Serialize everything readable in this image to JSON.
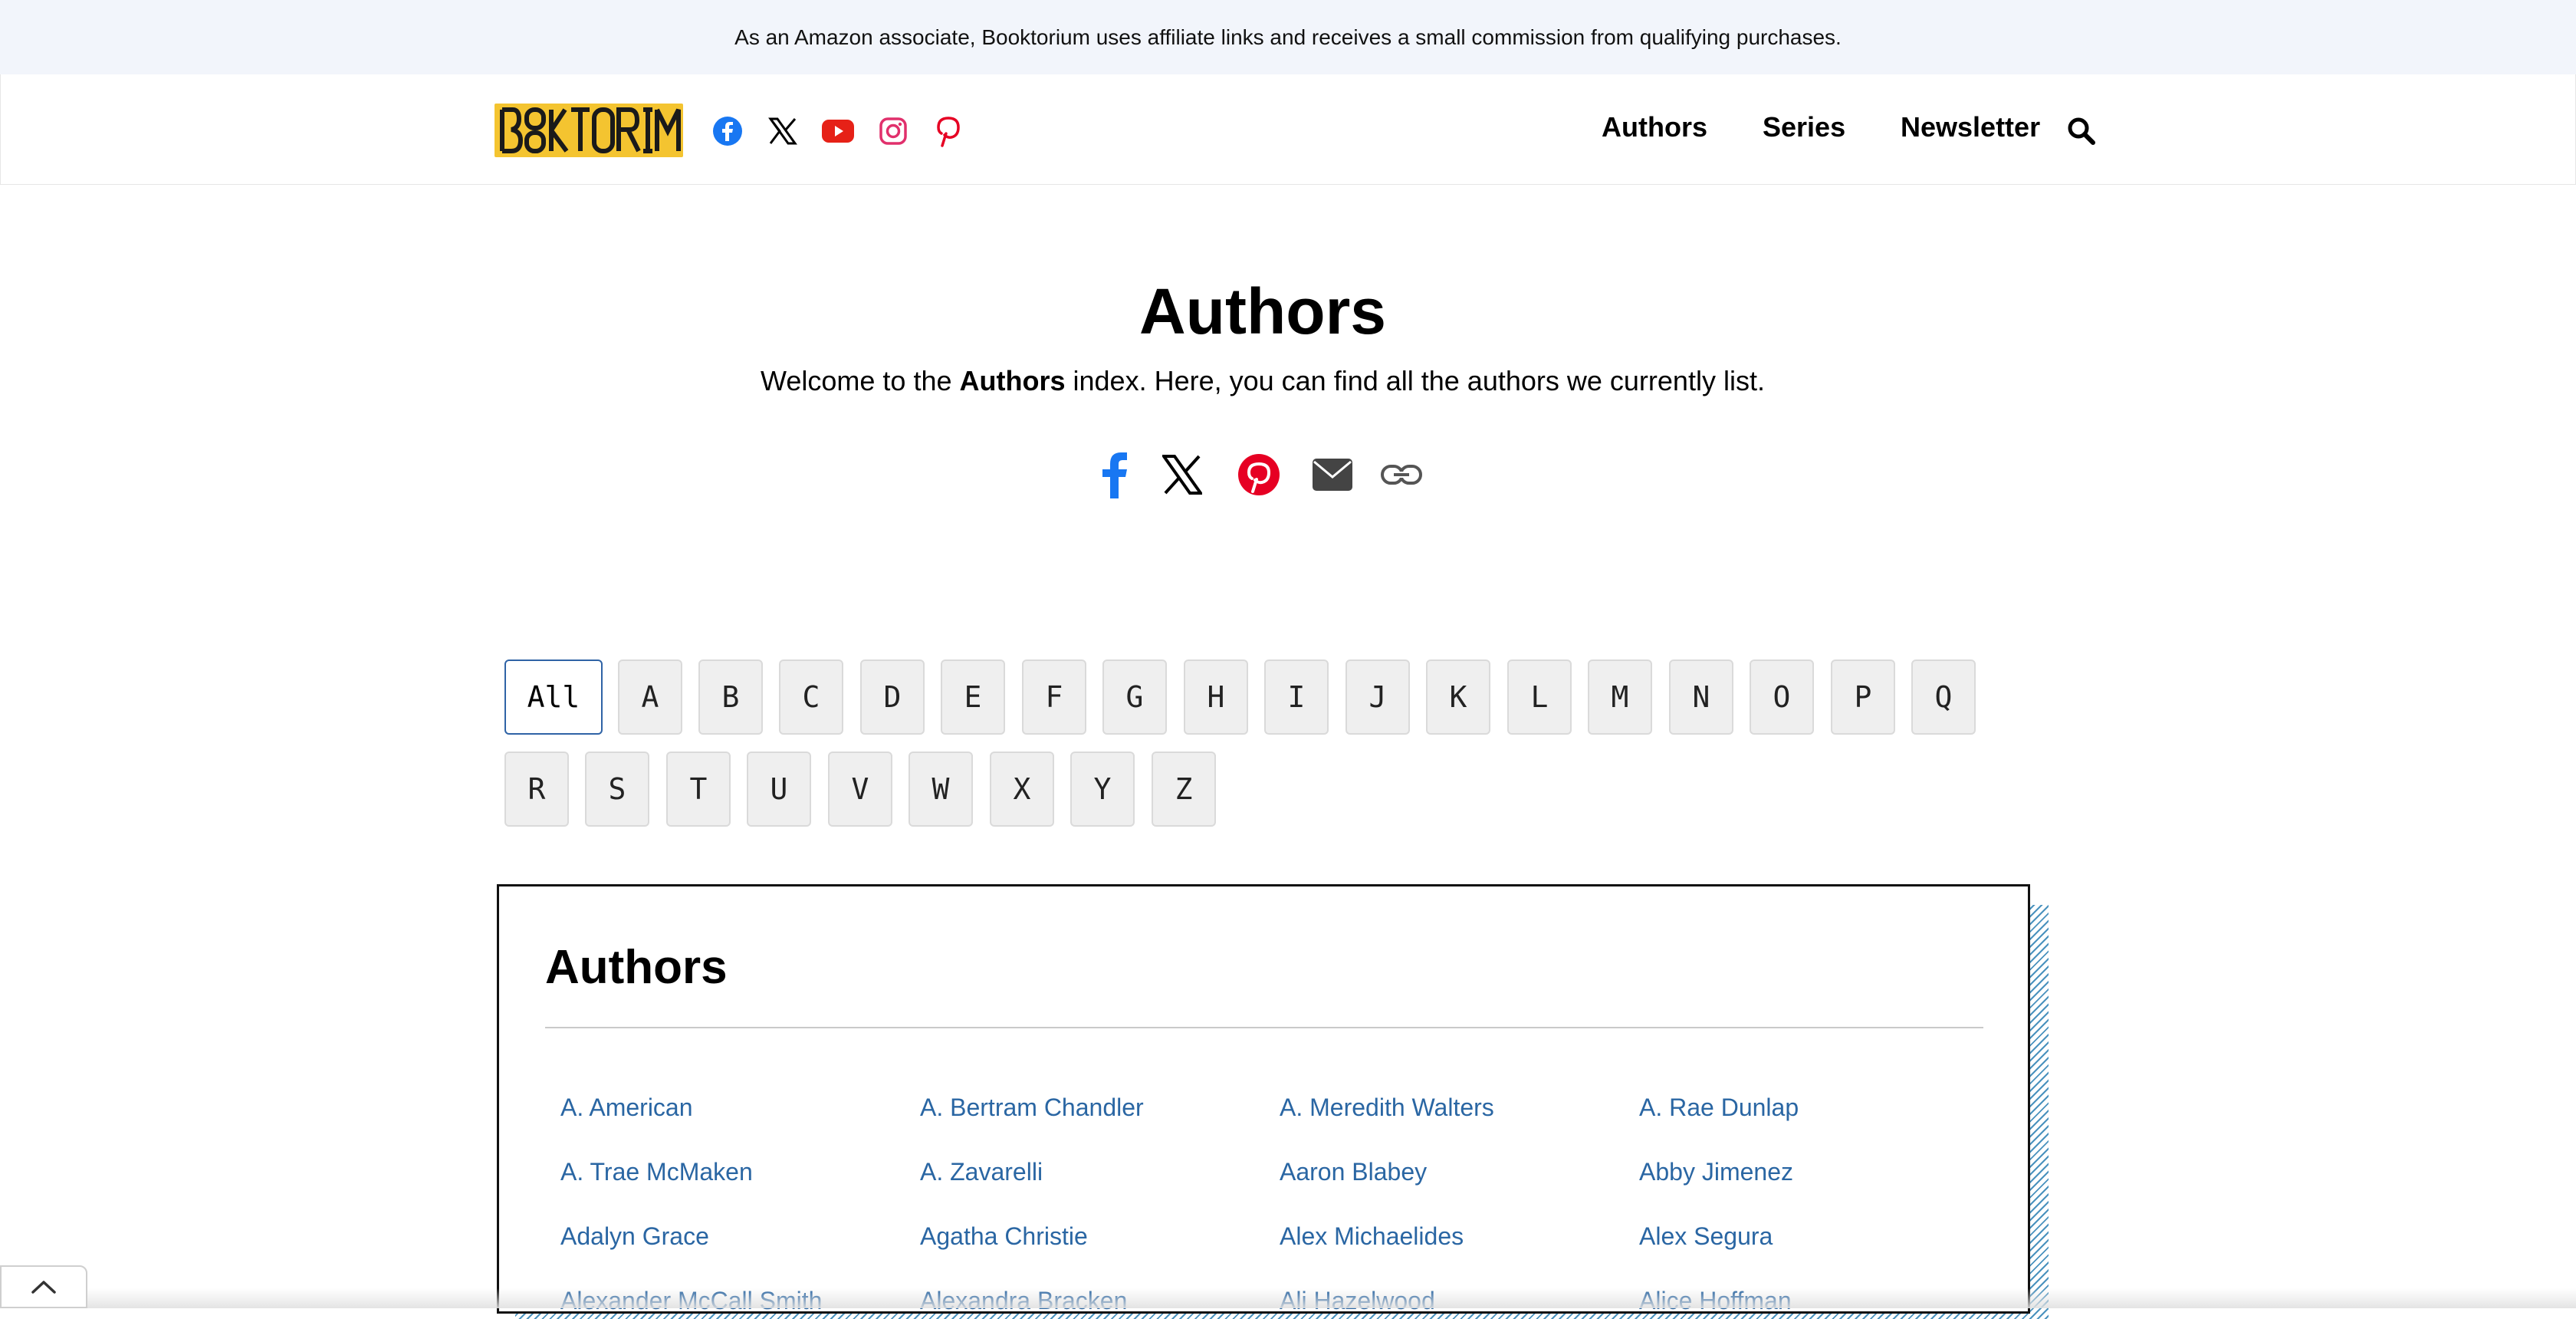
{
  "affiliate_notice": "As an Amazon associate, Booktorium uses affiliate links and receives a small commission from qualifying purchases.",
  "header": {
    "logo_text": "BOOKTORIUM",
    "social_icons": [
      "facebook-icon",
      "x-icon",
      "youtube-icon",
      "instagram-icon",
      "pinterest-icon"
    ],
    "nav": {
      "authors": "Authors",
      "series": "Series",
      "newsletter": "Newsletter"
    }
  },
  "page": {
    "title": "Authors",
    "intro_before": "Welcome to the ",
    "intro_bold": "Authors",
    "intro_after": " index. Here, you can find all the authors we currently list.",
    "share_icons": [
      "facebook-icon",
      "x-icon",
      "pinterest-icon",
      "email-icon",
      "link-icon"
    ]
  },
  "letters": [
    "All",
    "A",
    "B",
    "C",
    "D",
    "E",
    "F",
    "G",
    "H",
    "I",
    "J",
    "K",
    "L",
    "M",
    "N",
    "O",
    "P",
    "Q",
    "R",
    "S",
    "T",
    "U",
    "V",
    "W",
    "X",
    "Y",
    "Z"
  ],
  "authors_box": {
    "title": "Authors",
    "authors": [
      "A. American",
      "A. Bertram Chandler",
      "A. Meredith Walters",
      "A. Rae Dunlap",
      "A. Trae McMaken",
      "A. Zavarelli",
      "Aaron Blabey",
      "Abby Jimenez",
      "Adalyn Grace",
      "Agatha Christie",
      "Alex Michaelides",
      "Alex Segura",
      "Alexander McCall Smith",
      "Alexandra Bracken",
      "Ali Hazelwood",
      "Alice Hoffman"
    ]
  },
  "colors": {
    "accent_link": "#2a66a3",
    "facebook": "#1877f2",
    "youtube": "#e62117",
    "instagram": "#e1306c",
    "pinterest": "#e60023",
    "affiliate_bg": "#f2f5fb"
  }
}
